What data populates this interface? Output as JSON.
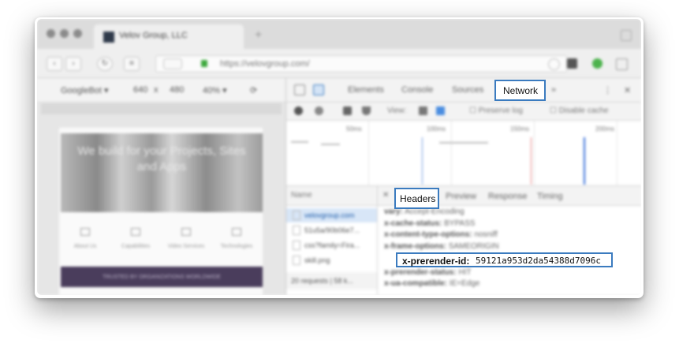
{
  "browser": {
    "tab_title": "Velov Group, LLC",
    "url": "https://velovgroup.com/"
  },
  "device_toolbar": {
    "device": "GoogleBot",
    "width": "640",
    "height": "480",
    "zoom": "40%"
  },
  "page": {
    "hero_text": "We build for your Projects, Sites and Apps",
    "features": [
      "About Us",
      "Capabilities",
      "Video Services",
      "Technologies"
    ],
    "banner_text": "TRUSTED BY ORGANIZATIONS WORLDWIDE"
  },
  "devtools": {
    "tabs": [
      "Elements",
      "Console",
      "Sources",
      "Network"
    ],
    "active_tab": "Network",
    "toolbar": {
      "view_label": "View:",
      "preserve_log": "Preserve log",
      "disable_cache": "Disable cache"
    },
    "timeline_ticks": [
      "50ms",
      "100ms",
      "150ms",
      "200ms"
    ],
    "name_header": "Name",
    "requests": [
      "velovgroup.com",
      "51u5a/90b06e7...",
      "css?family=Fira...",
      "skill.png"
    ],
    "summary": "20 requests | 58 k...",
    "detail_tabs": [
      "Headers",
      "Preview",
      "Response",
      "Timing"
    ],
    "active_detail_tab": "Headers",
    "headers": [
      {
        "name": "vary:",
        "value": "Accept-Encoding"
      },
      {
        "name": "x-cache-status:",
        "value": "BYPASS"
      },
      {
        "name": "x-content-type-options:",
        "value": "nosniff"
      },
      {
        "name": "x-frame-options:",
        "value": "SAMEORIGIN"
      },
      {
        "name": "x-prerender-id:",
        "value": "59121a953d2da54388d7096c"
      },
      {
        "name": "x-prerender-status:",
        "value": "HIT"
      },
      {
        "name": "x-ua-compatible:",
        "value": "IE=Edge"
      }
    ]
  },
  "colors": {
    "highlight_border": "#3b7bbf",
    "selected_row": "#d8e6f7"
  }
}
